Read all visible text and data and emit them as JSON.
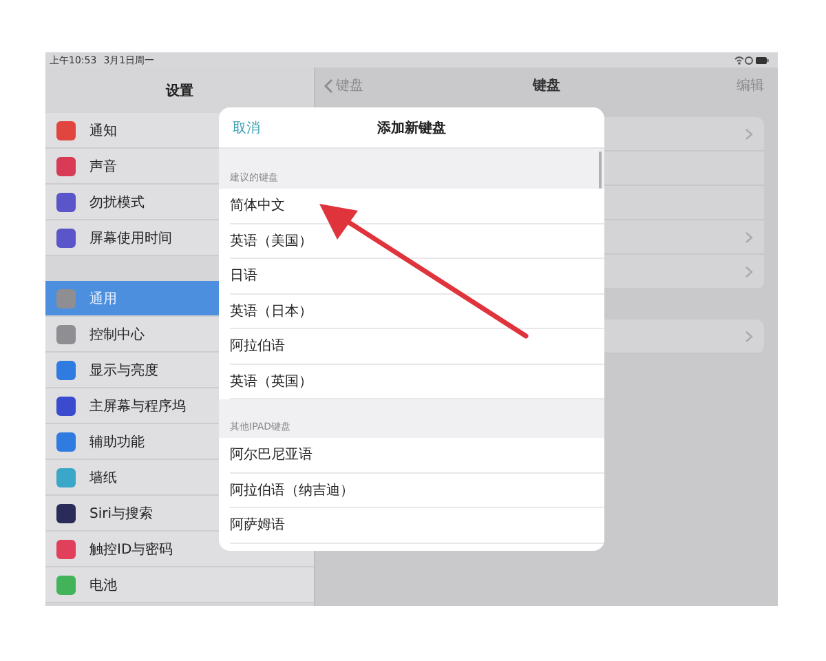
{
  "status_bar": {
    "time": "上午10:53",
    "date": "3月1日周一"
  },
  "sidebar": {
    "title": "设置",
    "groups": [
      {
        "items": [
          {
            "label": "通知",
            "color": "#e0463f",
            "selected": false
          },
          {
            "label": "声音",
            "color": "#d93a55",
            "selected": false
          },
          {
            "label": "勿扰模式",
            "color": "#5a56c9",
            "selected": false
          },
          {
            "label": "屏幕使用时间",
            "color": "#5a56c9",
            "selected": false
          }
        ]
      },
      {
        "items": [
          {
            "label": "通用",
            "color": "#8e8e93",
            "selected": true
          },
          {
            "label": "控制中心",
            "color": "#8e8e93",
            "selected": false
          },
          {
            "label": "显示与亮度",
            "color": "#2f7be0",
            "selected": false
          },
          {
            "label": "主屏幕与程序坞",
            "color": "#3a4bd0",
            "selected": false
          },
          {
            "label": "辅助功能",
            "color": "#2f7be0",
            "selected": false
          },
          {
            "label": "墙纸",
            "color": "#3aa7c9",
            "selected": false
          },
          {
            "label": "Siri与搜索",
            "color": "#2b2b5a",
            "selected": false
          },
          {
            "label": "触控ID与密码",
            "color": "#e0405a",
            "selected": false
          },
          {
            "label": "电池",
            "color": "#43b35a",
            "selected": false
          }
        ]
      }
    ]
  },
  "detail": {
    "back": "键盘",
    "title": "键盘",
    "action": "编辑",
    "groups": [
      {
        "rows": [
          {
            "chevron": true
          },
          {
            "chevron": false
          },
          {
            "chevron": false
          },
          {
            "chevron": true
          },
          {
            "chevron": true
          }
        ]
      },
      {
        "rows": [
          {
            "chevron": true
          }
        ]
      }
    ]
  },
  "modal": {
    "cancel": "取消",
    "title": "添加新键盘",
    "sections": [
      {
        "header": "建议的键盘",
        "rows": [
          "简体中文",
          "英语（美国）",
          "日语",
          "英语（日本）",
          "阿拉伯语",
          "英语（英国）"
        ]
      },
      {
        "header": "其他IPAD键盘",
        "rows": [
          "阿尔巴尼亚语",
          "阿拉伯语（纳吉迪）",
          "阿萨姆语"
        ]
      }
    ]
  }
}
